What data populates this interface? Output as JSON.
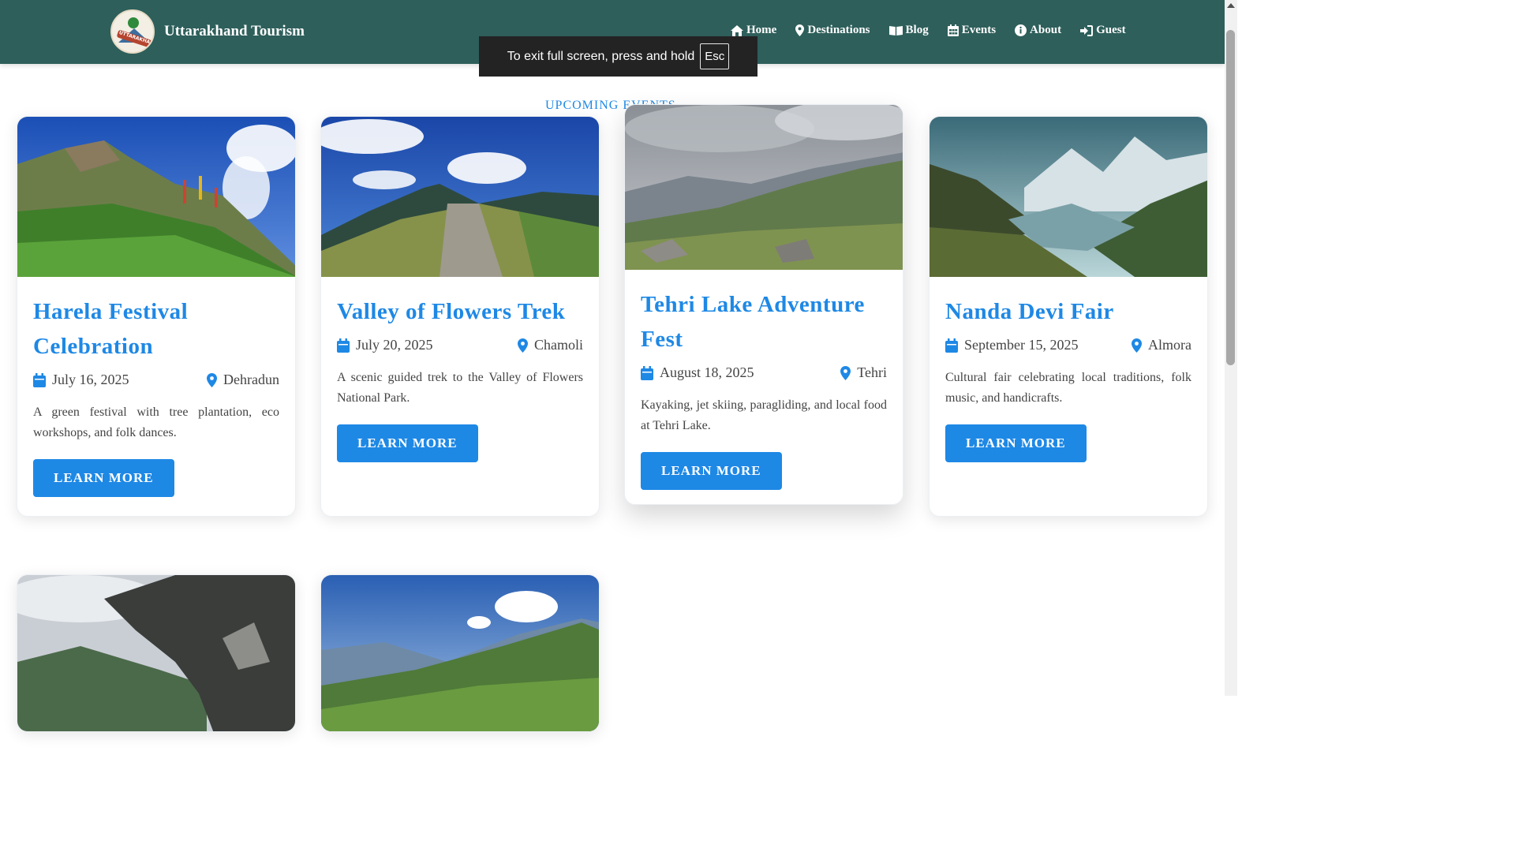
{
  "brand": {
    "name": "Uttarakhand Tourism",
    "logo_text": "UTTARAKHAND"
  },
  "nav": [
    {
      "label": "Home",
      "icon": "home-icon"
    },
    {
      "label": "Destinations",
      "icon": "map-pin-icon"
    },
    {
      "label": "Blog",
      "icon": "book-icon"
    },
    {
      "label": "Events",
      "icon": "calendar-icon"
    },
    {
      "label": "About",
      "icon": "info-icon"
    },
    {
      "label": "Guest",
      "icon": "sign-in-icon"
    }
  ],
  "fullscreen_notice": {
    "text": "To exit full screen, press and hold",
    "key": "Esc"
  },
  "section_title": "UPCOMING EVENTS",
  "events": [
    {
      "title": "Harela Festival Celebration",
      "date": "July 16, 2025",
      "location": "Dehradun",
      "description": "A green festival with tree plantation, eco workshops, and folk dances.",
      "button": "LEARN MORE"
    },
    {
      "title": "Valley of Flowers Trek",
      "date": "July 20, 2025",
      "location": "Chamoli",
      "description": "A scenic guided trek to the Valley of Flowers National Park.",
      "button": "LEARN MORE"
    },
    {
      "title": "Tehri Lake Adventure Fest",
      "date": "August 18, 2025",
      "location": "Tehri",
      "description": "Kayaking, jet skiing, paragliding, and local food at Tehri Lake.",
      "button": "LEARN MORE"
    },
    {
      "title": "Nanda Devi Fair",
      "date": "September 15, 2025",
      "location": "Almora",
      "description": "Cultural fair celebrating local traditions, folk music, and handicrafts.",
      "button": "LEARN MORE"
    }
  ],
  "colors": {
    "navbar": "#2e5f5b",
    "accent": "#1e88e5"
  }
}
